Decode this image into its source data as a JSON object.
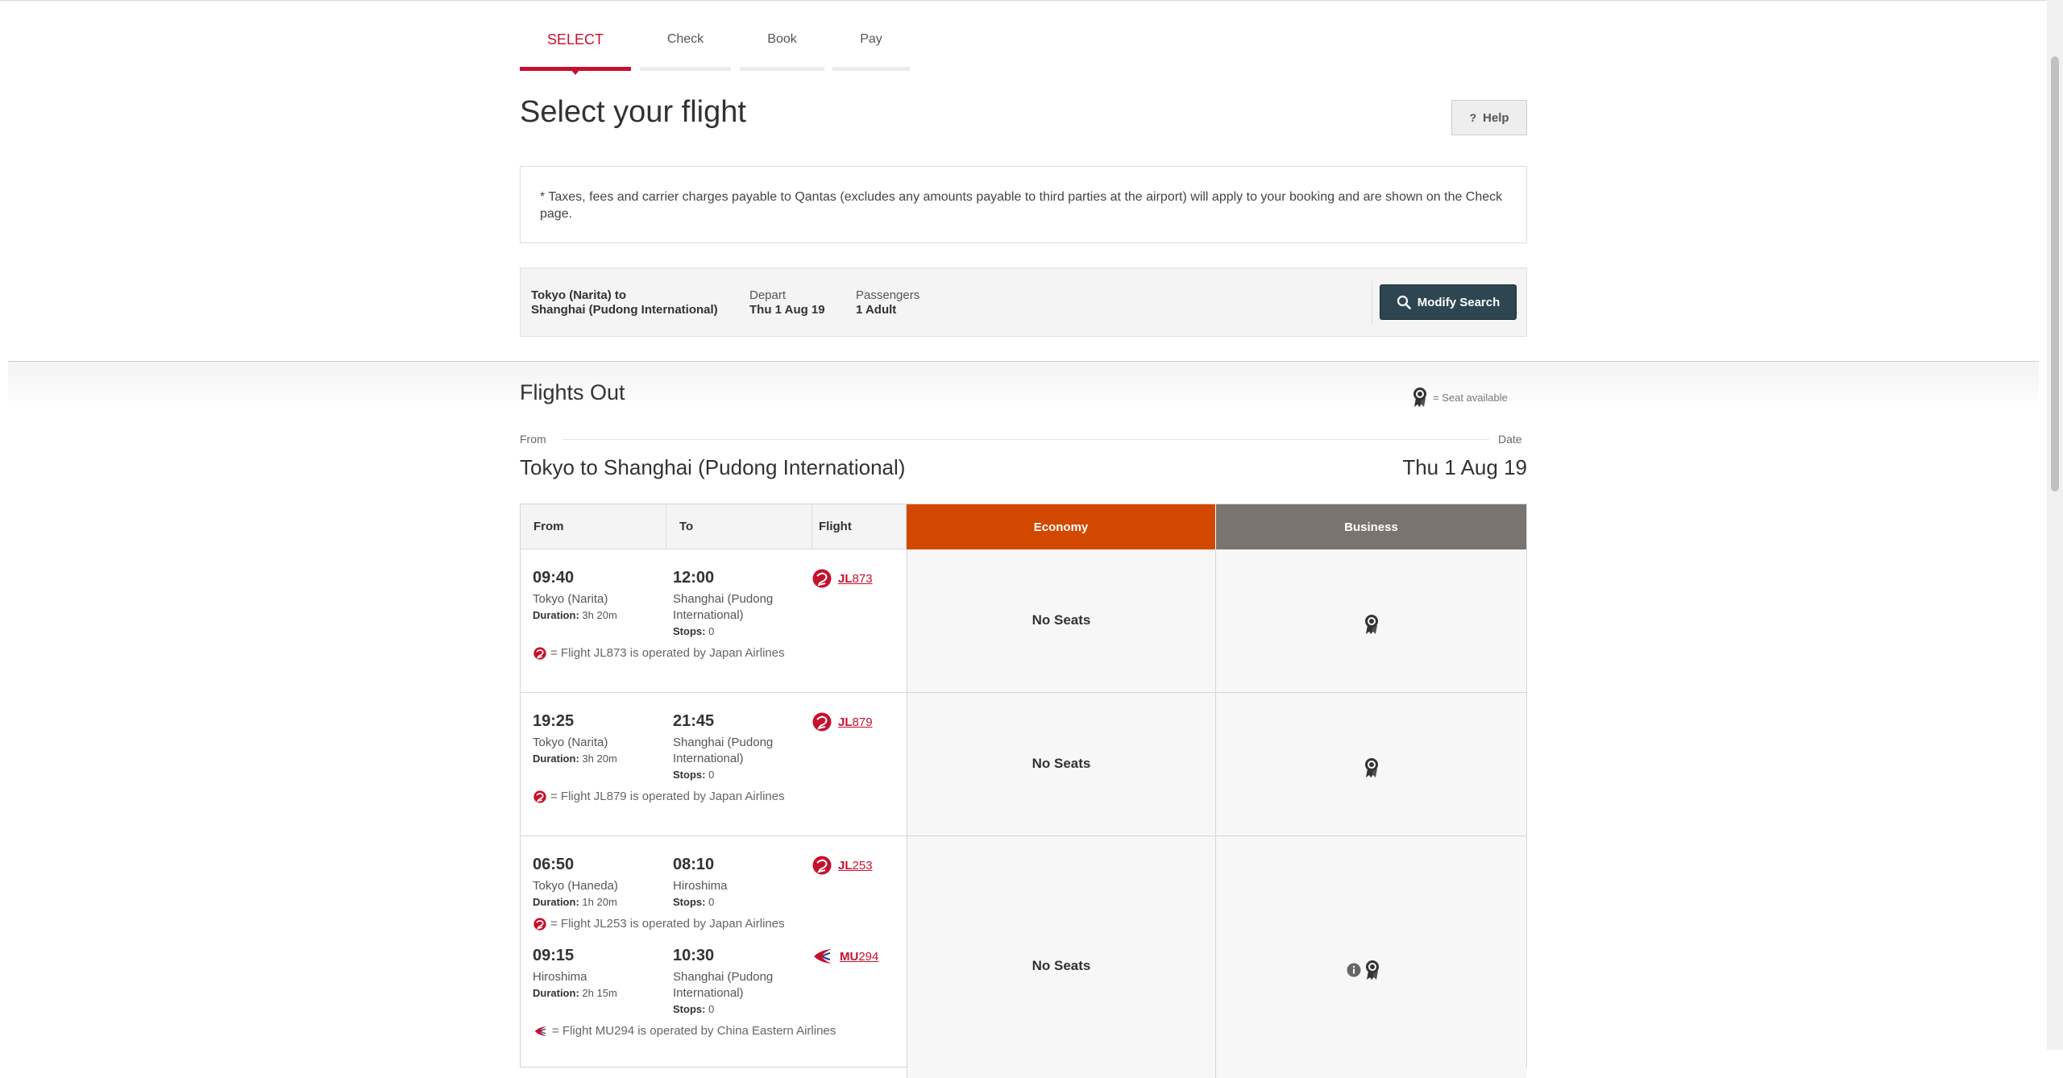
{
  "steps": [
    {
      "label": "SELECT",
      "active": true
    },
    {
      "label": "Check",
      "active": false
    },
    {
      "label": "Book",
      "active": false
    },
    {
      "label": "Pay",
      "active": false
    }
  ],
  "page_title": "Select your flight",
  "help_label": "Help",
  "notice": "* Taxes, fees and carrier charges payable to Qantas (excludes any amounts payable to third parties at the airport) will apply to your booking and are shown on the Check page.",
  "summary": {
    "route_line1": "Tokyo (Narita)  to",
    "route_line2": "Shanghai (Pudong International)",
    "depart_label": "Depart",
    "depart_value": "Thu 1 Aug 19",
    "passengers_label": "Passengers",
    "passengers_value": "1 Adult",
    "modify_label": "Modify Search"
  },
  "section_title": "Flights Out",
  "legend_text": "= Seat available",
  "from_label": "From",
  "date_label": "Date",
  "route_title": "Tokyo to Shanghai (Pudong International)",
  "date_title": "Thu 1 Aug 19",
  "table": {
    "headers": {
      "from": "From",
      "to": "To",
      "flight": "Flight",
      "economy": "Economy",
      "business": "Business"
    },
    "rows": [
      {
        "economy": "No Seats",
        "segments": [
          {
            "dep_time": "09:40",
            "dep_place": "Tokyo (Narita)",
            "duration_label": "Duration:",
            "duration": "3h 20m",
            "arr_time": "12:00",
            "arr_place_1": "Shanghai (Pudong",
            "arr_place_2": "International)",
            "stops_label": "Stops:",
            "stops": "0",
            "flight_prefix": "JL",
            "flight_num": "873",
            "operated": "= Flight JL873 is operated by Japan Airlines"
          }
        ]
      },
      {
        "economy": "No Seats",
        "segments": [
          {
            "dep_time": "19:25",
            "dep_place": "Tokyo (Narita)",
            "duration_label": "Duration:",
            "duration": "3h 20m",
            "arr_time": "21:45",
            "arr_place_1": "Shanghai (Pudong",
            "arr_place_2": "International)",
            "stops_label": "Stops:",
            "stops": "0",
            "flight_prefix": "JL",
            "flight_num": "879",
            "operated": "= Flight JL879 is operated by Japan Airlines"
          }
        ]
      },
      {
        "economy": "No Seats",
        "segments": [
          {
            "dep_time": "06:50",
            "dep_place": "Tokyo (Haneda)",
            "duration_label": "Duration:",
            "duration": "1h 20m",
            "arr_time": "08:10",
            "arr_place_1": "Hiroshima",
            "stops_label": "Stops:",
            "stops": "0",
            "flight_prefix": "JL",
            "flight_num": "253",
            "operated": "= Flight JL253 is operated by Japan Airlines"
          },
          {
            "dep_time": "09:15",
            "dep_place": "Hiroshima",
            "duration_label": "Duration:",
            "duration": "2h 15m",
            "arr_time": "10:30",
            "arr_place_1": "Shanghai (Pudong",
            "arr_place_2": "International)",
            "stops_label": "Stops:",
            "stops": "0",
            "flight_prefix": "MU",
            "flight_num": "294",
            "operated": "= Flight MU294 is operated by China Eastern Airlines"
          }
        ]
      }
    ]
  },
  "colors": {
    "qantas_red": "#c8102e",
    "economy": "#d34800",
    "business": "#7a7470",
    "modify_btn": "#2d4651"
  },
  "icons": [
    "search-icon",
    "seat-available-icon",
    "japan-airlines-logo-icon",
    "china-eastern-logo-icon",
    "info-icon",
    "help-icon"
  ]
}
